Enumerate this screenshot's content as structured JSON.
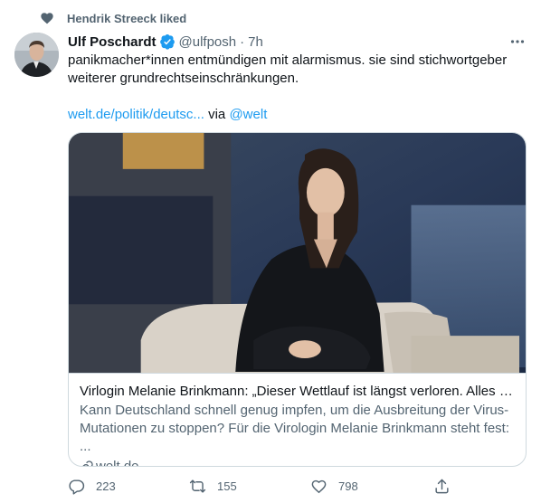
{
  "social_context": {
    "text": "Hendrik Streeck liked",
    "icon": "heart-icon"
  },
  "author": {
    "name": "Ulf Poschardt",
    "handle": "@ulfposh",
    "separator": "·",
    "time": "7h",
    "verified": true
  },
  "tweet": {
    "line1": "panikmacher*innen entmündigen mit alarmismus. sie sind stichwortgeber",
    "line2": "weiterer grundrechtseinschränkungen.",
    "link_text": "welt.de/politik/deutsc...",
    "via_text": "via",
    "via_handle": "@welt"
  },
  "card": {
    "title": "Virlogin Melanie Brinkmann: „Dieser Wettlauf ist längst verloren. Alles a...",
    "desc_line1": "Kann Deutschland schnell genug impfen, um die Ausbreitung der Virus-",
    "desc_line2": "Mutationen zu stoppen? Für die Virologin Melanie Brinkmann steht fest: ...",
    "domain": "welt.de"
  },
  "actions": {
    "replies": "223",
    "retweets": "155",
    "likes": "798"
  },
  "colors": {
    "accent": "#1d9bf0",
    "secondary_text": "#536471",
    "primary_text": "#0f1419",
    "border": "#cfd9de"
  }
}
